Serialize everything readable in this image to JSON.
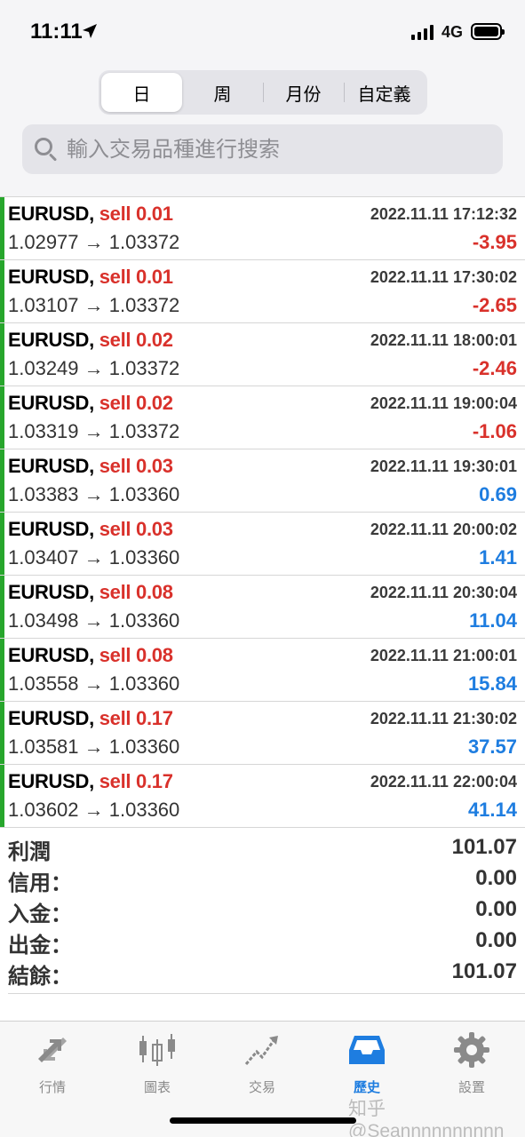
{
  "status_bar": {
    "time": "11:11",
    "network": "4G"
  },
  "segments": [
    {
      "label": "日",
      "active": true
    },
    {
      "label": "周",
      "active": false
    },
    {
      "label": "月份",
      "active": false
    },
    {
      "label": "自定義",
      "active": false
    }
  ],
  "search": {
    "placeholder": "輸入交易品種進行搜索"
  },
  "trades": [
    {
      "symbol": "EURUSD,",
      "type": "sell 0.01",
      "time": "2022.11.11 17:12:32",
      "prices": "1.02977 → 1.03372",
      "profit": "-3.95",
      "sign": "neg"
    },
    {
      "symbol": "EURUSD,",
      "type": "sell 0.01",
      "time": "2022.11.11 17:30:02",
      "prices": "1.03107 → 1.03372",
      "profit": "-2.65",
      "sign": "neg"
    },
    {
      "symbol": "EURUSD,",
      "type": "sell 0.02",
      "time": "2022.11.11 18:00:01",
      "prices": "1.03249 → 1.03372",
      "profit": "-2.46",
      "sign": "neg"
    },
    {
      "symbol": "EURUSD,",
      "type": "sell 0.02",
      "time": "2022.11.11 19:00:04",
      "prices": "1.03319 → 1.03372",
      "profit": "-1.06",
      "sign": "neg"
    },
    {
      "symbol": "EURUSD,",
      "type": "sell 0.03",
      "time": "2022.11.11 19:30:01",
      "prices": "1.03383 → 1.03360",
      "profit": "0.69",
      "sign": "pos"
    },
    {
      "symbol": "EURUSD,",
      "type": "sell 0.03",
      "time": "2022.11.11 20:00:02",
      "prices": "1.03407 → 1.03360",
      "profit": "1.41",
      "sign": "pos"
    },
    {
      "symbol": "EURUSD,",
      "type": "sell 0.08",
      "time": "2022.11.11 20:30:04",
      "prices": "1.03498 → 1.03360",
      "profit": "11.04",
      "sign": "pos"
    },
    {
      "symbol": "EURUSD,",
      "type": "sell 0.08",
      "time": "2022.11.11 21:00:01",
      "prices": "1.03558 → 1.03360",
      "profit": "15.84",
      "sign": "pos"
    },
    {
      "symbol": "EURUSD,",
      "type": "sell 0.17",
      "time": "2022.11.11 21:30:02",
      "prices": "1.03581 → 1.03360",
      "profit": "37.57",
      "sign": "pos"
    },
    {
      "symbol": "EURUSD,",
      "type": "sell 0.17",
      "time": "2022.11.11 22:00:04",
      "prices": "1.03602 → 1.03360",
      "profit": "41.14",
      "sign": "pos"
    }
  ],
  "summary": [
    {
      "label": "利潤",
      "value": "101.07"
    },
    {
      "label": "信用：",
      "value": "0.00"
    },
    {
      "label": "入金：",
      "value": "0.00"
    },
    {
      "label": "出金：",
      "value": "0.00"
    },
    {
      "label": "結餘：",
      "value": "101.07"
    }
  ],
  "tabs": [
    {
      "label": "行情",
      "icon": "arrows-icon",
      "active": false
    },
    {
      "label": "圖表",
      "icon": "candlestick-icon",
      "active": false
    },
    {
      "label": "交易",
      "icon": "trend-icon",
      "active": false
    },
    {
      "label": "歷史",
      "icon": "inbox-icon",
      "active": true
    },
    {
      "label": "設置",
      "icon": "gear-icon",
      "active": false
    }
  ],
  "watermark": "知乎 @Seannnnnnnnnn",
  "colors": {
    "sell": "#d9312b",
    "loss": "#d9312b",
    "gain": "#1e7de0",
    "bar": "#27a62c",
    "active_tab": "#1e7de0"
  }
}
